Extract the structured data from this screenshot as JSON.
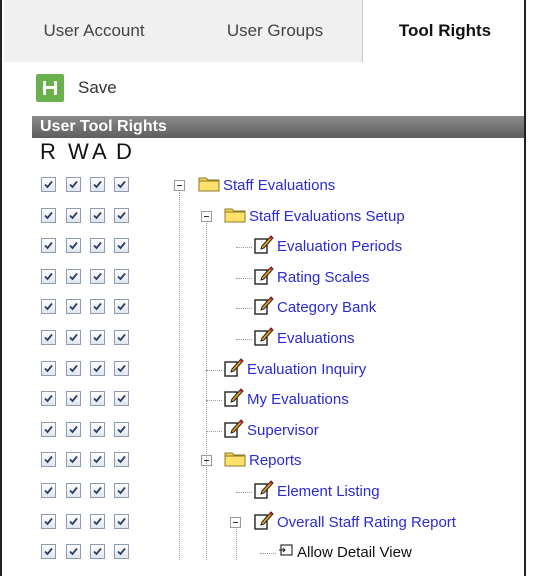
{
  "tabs": [
    {
      "label": "User Account"
    },
    {
      "label": "User Groups"
    },
    {
      "label": "Tool Rights"
    }
  ],
  "toolbar": {
    "save_label": "Save"
  },
  "section": {
    "title": "User Tool Rights"
  },
  "columns": [
    "R",
    "W",
    "A",
    "D"
  ],
  "tree": [
    {
      "label": "Staff Evaluations",
      "icon": "folder-icon",
      "checked": [
        true,
        true,
        true,
        true
      ]
    },
    {
      "label": "Staff Evaluations Setup",
      "icon": "folder-icon",
      "checked": [
        true,
        true,
        true,
        true
      ]
    },
    {
      "label": "Evaluation Periods",
      "icon": "edit-tool-icon",
      "checked": [
        true,
        true,
        true,
        true
      ]
    },
    {
      "label": "Rating Scales",
      "icon": "edit-tool-icon",
      "checked": [
        true,
        true,
        true,
        true
      ]
    },
    {
      "label": "Category Bank",
      "icon": "edit-tool-icon",
      "checked": [
        true,
        true,
        true,
        true
      ]
    },
    {
      "label": "Evaluations",
      "icon": "edit-tool-icon",
      "checked": [
        true,
        true,
        true,
        true
      ]
    },
    {
      "label": "Evaluation Inquiry",
      "icon": "edit-tool-icon",
      "checked": [
        true,
        true,
        true,
        true
      ]
    },
    {
      "label": "My Evaluations",
      "icon": "edit-tool-icon",
      "checked": [
        true,
        true,
        true,
        true
      ]
    },
    {
      "label": "Supervisor",
      "icon": "edit-tool-icon",
      "checked": [
        true,
        true,
        true,
        true
      ]
    },
    {
      "label": "Reports",
      "icon": "folder-icon",
      "checked": [
        true,
        true,
        true,
        true
      ]
    },
    {
      "label": "Element Listing",
      "icon": "edit-tool-icon",
      "checked": [
        true,
        true,
        true,
        true
      ]
    },
    {
      "label": "Overall Staff Rating Report",
      "icon": "edit-tool-icon",
      "checked": [
        true,
        true,
        true,
        true
      ]
    },
    {
      "label": "Allow Detail View",
      "icon": "sub-right-icon",
      "checked": [
        true,
        true,
        true,
        true
      ]
    }
  ],
  "colors": {
    "link": "#2a2ad6",
    "save_green": "#6ab04c",
    "header_gray": "#6e6e6e"
  }
}
